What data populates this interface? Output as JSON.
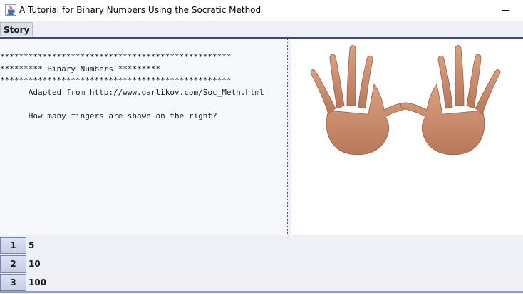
{
  "window": {
    "title": "A Tutorial for Binary Numbers Using the Socratic Method",
    "icon": "java-cup-icon",
    "minimize_glyph": "—"
  },
  "menubar": {
    "items": [
      {
        "label": "Story"
      }
    ]
  },
  "story": {
    "text": "*************************************************\n********* Binary Numbers *********\n*************************************************\n      Adapted from http://www.garlikov.com/Soc_Meth.html\n\n      How many fingers are shown on the right?"
  },
  "image": {
    "description_icon": "two-open-hands-icon"
  },
  "answers": [
    {
      "number": "1",
      "label": "5"
    },
    {
      "number": "2",
      "label": "10"
    },
    {
      "number": "3",
      "label": "100"
    }
  ],
  "colors": {
    "accent_rule": "#3a4a7a",
    "button_fill": "#c5cde6",
    "pane_background": "#f7f8fb"
  }
}
